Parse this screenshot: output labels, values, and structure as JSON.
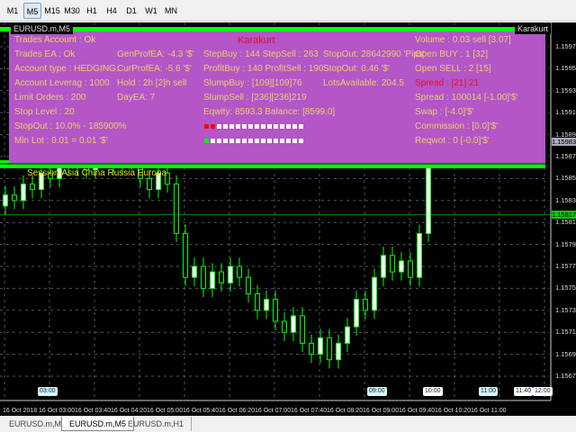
{
  "toolbar": {
    "timeframes": [
      "M1",
      "M5",
      "M15",
      "M30",
      "H1",
      "H4",
      "D1",
      "W1",
      "MN"
    ],
    "active": "M5"
  },
  "chart": {
    "window_title": "EURUSD.m,M5",
    "indicator_name": "Karakurt",
    "panel": {
      "title": "Karakurt",
      "col1": [
        "Trades Account : Ok",
        "Trades EA  : Ok",
        "Account type :  HEDGING.",
        "Account Leverag :  1000",
        "Limit Orders  : 200",
        "Stop Level  : 20",
        "StopOut  : 10.0% - 185900%",
        "Min Lot : 0.01 = 0.01 '$'"
      ],
      "col2": [
        "GenProfEA: -4.3 '$'",
        "CurProfEA: -5.6 '$'",
        "Hold : 2h [2]h sell",
        "DayEA: 7"
      ],
      "col3": [
        "StepBuy : 144 StepSell : 263",
        "ProfitBuy : 140 ProfitSell : 190",
        "SlumpBuy : [109][109]76",
        "SlumpSell : [236][236]219",
        "Eqwity: 8593.3 Balance: [8599.0]"
      ],
      "col4": [
        "StopOut: 28642990 'Pips'",
        "StopOut: 0.46 '$'",
        "LotsAvailable: 204.5"
      ],
      "col5": [
        "Volume : 0.03 sell [3.07]",
        "Open  BUY  : 1 [32]",
        "Open  SELL : 2 [15]",
        "Spread : [21] 21",
        "Spread : 100014 [-1.00]'$'",
        "Swap : [-4.0]'$'",
        "Commission : [0.0]'$'",
        "Reqwot : 0 [-0.0]'$'"
      ],
      "buy_squares_red": 2,
      "sell_squares_green": 1,
      "squares_total": 16
    },
    "session_text": "Session:Asia China Russia Europa",
    "colors": {
      "panel": "#b455c8",
      "text": "#e6d26a",
      "red": "#e0102a",
      "green": "#00ff00",
      "bull": "#ffffff",
      "bear": "#000000"
    }
  },
  "chart_data": {
    "type": "candlestick",
    "symbol": "EURUSD.m",
    "timeframe": "M5",
    "ylim": [
      1.1566,
      1.1599
    ],
    "y_ticks": [
      "1.15970",
      "1.15950",
      "1.15930",
      "1.15910",
      "1.15890",
      "1.15870",
      "1.15850",
      "1.15830",
      "1.15810",
      "1.15790",
      "1.15770",
      "1.15750",
      "1.15730",
      "1.15710",
      "1.15690",
      "1.15670"
    ],
    "current_bid": "1.15983",
    "line_price": "1.15817",
    "x_ticks": [
      "16 Oct 2018",
      "16 Oct 03:00",
      "16 Oct 03:40",
      "16 Oct 04:20",
      "16 Oct 05:00",
      "16 Oct 05:40",
      "16 Oct 06:20",
      "16 Oct 07:00",
      "16 Oct 07:40",
      "16 Oct 08:20",
      "16 Oct 09:00",
      "16 Oct 09:40",
      "16 Oct 10:20",
      "16 Oct 11:00"
    ],
    "time_markers": [
      "03:00",
      "09:00",
      "10:00",
      "11:00",
      "11:40",
      "12:00"
    ],
    "open": 1.15825,
    "closes": [
      1.15835,
      1.1583,
      1.15845,
      1.1584,
      1.15855,
      1.1585,
      1.15865,
      1.1586,
      1.1587,
      1.15858,
      1.15868,
      1.15875,
      1.15862,
      1.15872,
      1.15866,
      1.1585,
      1.1584,
      1.15855,
      1.15845,
      1.158,
      1.1576,
      1.1577,
      1.1575,
      1.15765,
      1.15755,
      1.1577,
      1.1576,
      1.15745,
      1.1573,
      1.1574,
      1.1572,
      1.1571,
      1.15725,
      1.157,
      1.1569,
      1.15705,
      1.15685,
      1.157,
      1.15715,
      1.1574,
      1.1573,
      1.1576,
      1.1578,
      1.15765,
      1.15775,
      1.1576,
      1.158,
      1.1589,
      1.1594,
      1.1592,
      1.1595,
      1.15935,
      1.159,
      1.1588,
      1.15875
    ]
  },
  "tabs": [
    "EURUSD.m,M5",
    "EURUSD.m,M5",
    "EURUSD.m,H1"
  ],
  "active_tab": 1
}
